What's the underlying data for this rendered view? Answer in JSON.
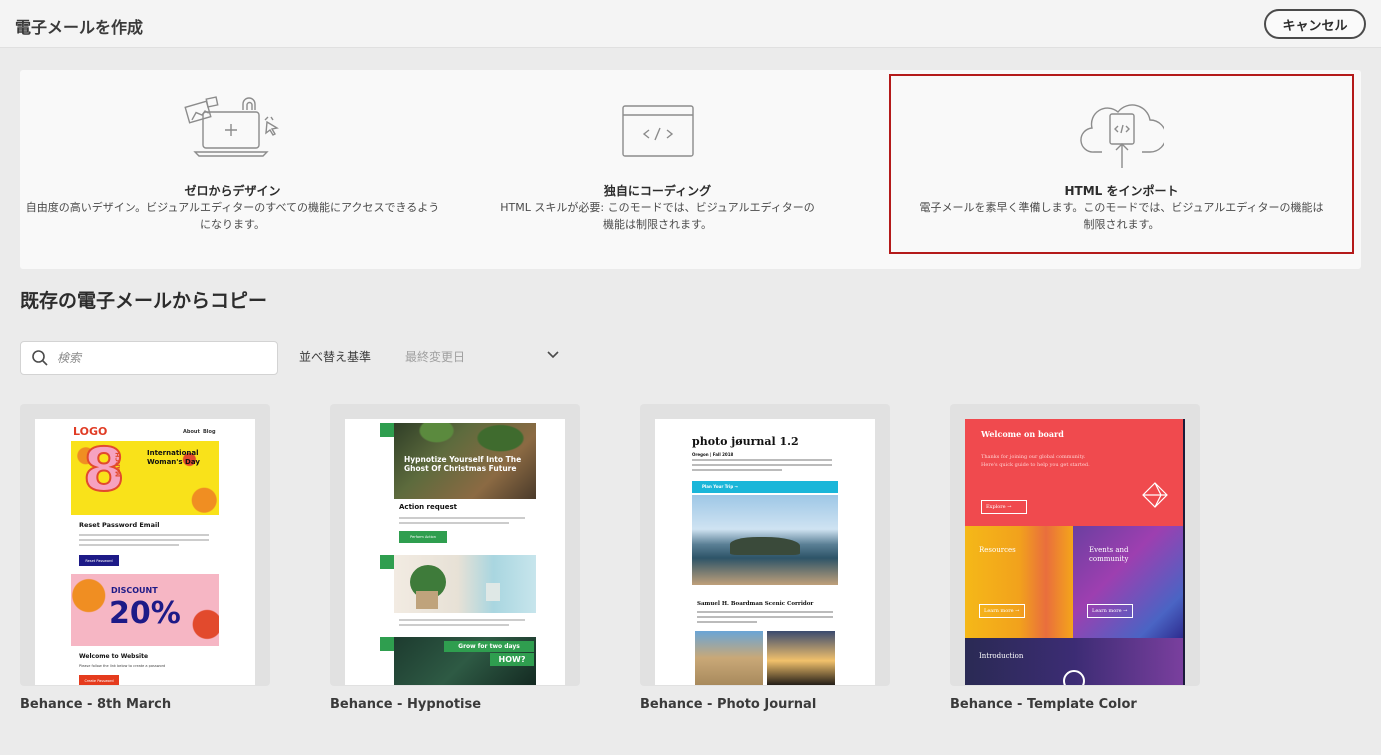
{
  "header": {
    "title": "電子メールを作成",
    "cancel_label": "キャンセル"
  },
  "options": [
    {
      "icon": "design-canvas-icon",
      "title": "ゼロからデザイン",
      "description": "自由度の高いデザイン。ビジュアルエディターのすべての機能にアクセスできるようになります。"
    },
    {
      "icon": "code-window-icon",
      "title": "独自にコーディング",
      "description": "HTML スキルが必要: このモードでは、ビジュアルエディターの機能は制限されます。"
    },
    {
      "icon": "cloud-upload-code-icon",
      "title": "HTML をインポート",
      "description": "電子メールを素早く準備します。このモードでは、ビジュアルエディターの機能は制限されます。",
      "highlighted": true
    }
  ],
  "copy_section": {
    "title": "既存の電子メールからコピー",
    "search_placeholder": "検索",
    "sort_label": "並べ替え基準",
    "sort_value": "最終変更日"
  },
  "templates": [
    {
      "name": "Behance - 8th March",
      "preview": {
        "logo": "LOGO",
        "nav": [
          "About",
          "Blog"
        ],
        "hero_number": "8",
        "hero_month": "MARCH",
        "hero_text": "International Woman's Day",
        "section1_title": "Reset Password Email",
        "section1_button": "Reset Password",
        "discount_label": "DISCOUNT",
        "discount_value": "20%",
        "section2_title": "Welcome to Website",
        "section2_text": "Please follow the link below to create a password",
        "section2_button": "Create Password"
      }
    },
    {
      "name": "Behance - Hypnotise",
      "preview": {
        "hero_text": "Hypnotize Yourself Into The Ghost Of Christmas Future",
        "action_title": "Action request",
        "action_button": "Perform Action",
        "promo_line1": "Grow for two days",
        "promo_line2": "HOW?"
      }
    },
    {
      "name": "Behance - Photo Journal",
      "preview": {
        "title": "photo jøurnal 1.2",
        "subtitle": "Oregon | Fall 2018",
        "banner": "Plan Your Trip  →",
        "section_title": "Samuel H. Boardman Scenic Corridor"
      }
    },
    {
      "name": "Behance - Template Color",
      "preview": {
        "title": "Welcome on board",
        "description": "Thanks for joining our global community. Here's quick guide to help you get started.",
        "explore": "Explore  →",
        "resources": "Resources",
        "events": "Events and community",
        "learn_more": "Learn more  →",
        "intro": "Introduction"
      }
    }
  ],
  "colors": {
    "background": "#ebebeb",
    "panel": "#f9f9f9",
    "highlight_border": "#b41a1a"
  }
}
